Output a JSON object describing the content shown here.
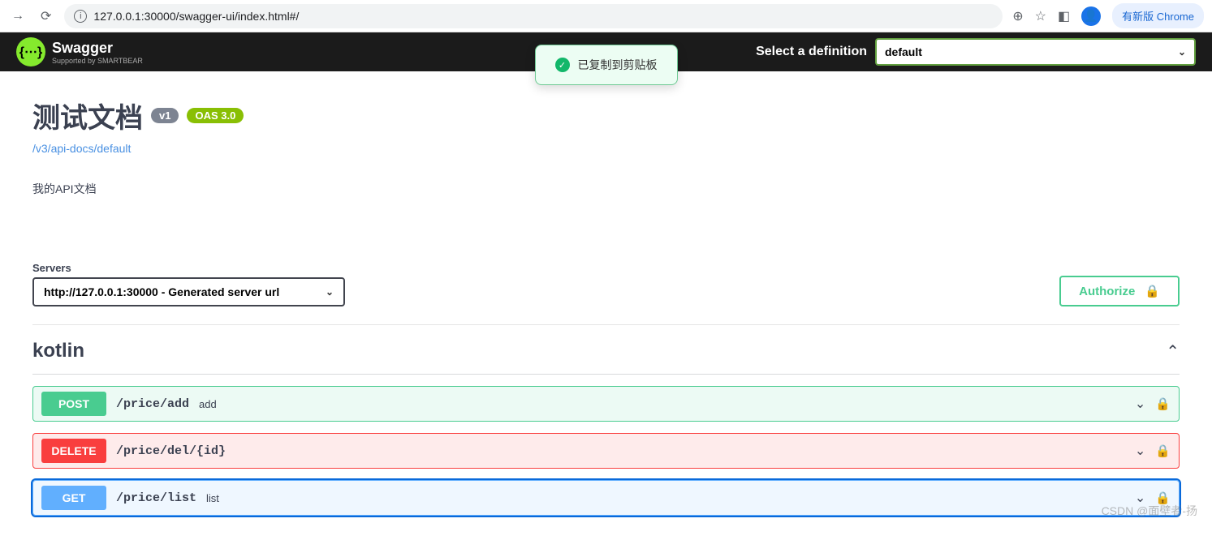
{
  "browser": {
    "url": "127.0.0.1:30000/swagger-ui/index.html#/",
    "update_label": "有新版 Chrome"
  },
  "header": {
    "logo_name": "Swagger",
    "logo_sub": "Supported by SMARTBEAR",
    "definition_label": "Select a definition",
    "definition_value": "default"
  },
  "toast": {
    "message": "已复制到剪贴板"
  },
  "info": {
    "title": "测试文档",
    "version": "v1",
    "oas": "OAS 3.0",
    "api_link": "/v3/api-docs/default",
    "description": "我的API文档"
  },
  "servers": {
    "label": "Servers",
    "selected": "http://127.0.0.1:30000 - Generated server url"
  },
  "authorize": {
    "label": "Authorize"
  },
  "tag": {
    "name": "kotlin"
  },
  "operations": [
    {
      "method": "POST",
      "method_class": "post",
      "path": "/price/add",
      "summary": "add"
    },
    {
      "method": "DELETE",
      "method_class": "delete",
      "path": "/price/del/{id}",
      "summary": ""
    },
    {
      "method": "GET",
      "method_class": "get",
      "path": "/price/list",
      "summary": "list"
    }
  ],
  "watermark": "CSDN @面壁者-扬"
}
